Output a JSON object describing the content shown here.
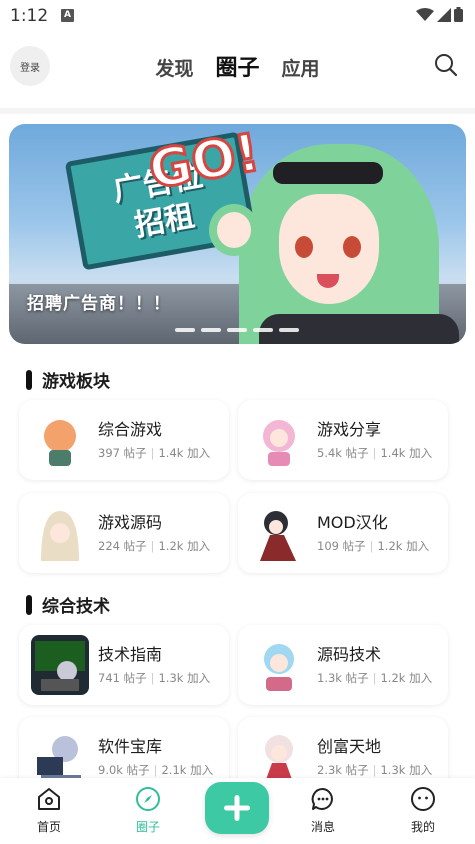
{
  "status_bar": {
    "time": "1:12",
    "notification_letter": "A"
  },
  "header": {
    "login_label": "登录",
    "tabs": [
      {
        "label": "发现"
      },
      {
        "label": "圈子"
      },
      {
        "label": "应用"
      }
    ],
    "active_tab": "圈子"
  },
  "banner": {
    "sign_line1": "广告位",
    "sign_line2": "招租",
    "sign_go": "GO!",
    "caption": "招聘广告商！！！",
    "page_count": 5
  },
  "sections": [
    {
      "title": "游戏板块",
      "cards": [
        {
          "name": "综合游戏",
          "posts": "397 帖子",
          "members": "1.4k 加入",
          "thumb_color": "#f3a26b"
        },
        {
          "name": "游戏分享",
          "posts": "5.4k 帖子",
          "members": "1.4k 加入",
          "thumb_color": "#f3b6d4"
        },
        {
          "name": "游戏源码",
          "posts": "224 帖子",
          "members": "1.2k 加入",
          "thumb_color": "#e9ddc6"
        },
        {
          "name": "MOD汉化",
          "posts": "109 帖子",
          "members": "1.2k 加入",
          "thumb_color": "#8a2a2a"
        }
      ]
    },
    {
      "title": "综合技术",
      "cards": [
        {
          "name": "技术指南",
          "posts": "741 帖子",
          "members": "1.3k 加入",
          "thumb_color": "#1f2a33"
        },
        {
          "name": "源码技术",
          "posts": "1.3k 帖子",
          "members": "1.2k 加入",
          "thumb_color": "#9fd8f0"
        },
        {
          "name": "软件宝库",
          "posts": "9.0k 帖子",
          "members": "2.1k 加入",
          "thumb_color": "#b9c2da"
        },
        {
          "name": "创富天地",
          "posts": "2.3k 帖子",
          "members": "1.3k 加入",
          "thumb_color": "#f1e1e1"
        }
      ]
    }
  ],
  "bottom_nav": [
    {
      "label": "首页",
      "icon": "home-icon"
    },
    {
      "label": "圈子",
      "icon": "compass-icon"
    },
    {
      "label": "",
      "icon": "plus-icon"
    },
    {
      "label": "消息",
      "icon": "message-icon"
    },
    {
      "label": "我的",
      "icon": "profile-icon"
    }
  ],
  "colors": {
    "accent": "#3dc9a3",
    "active_nav": "#2fbf98"
  }
}
